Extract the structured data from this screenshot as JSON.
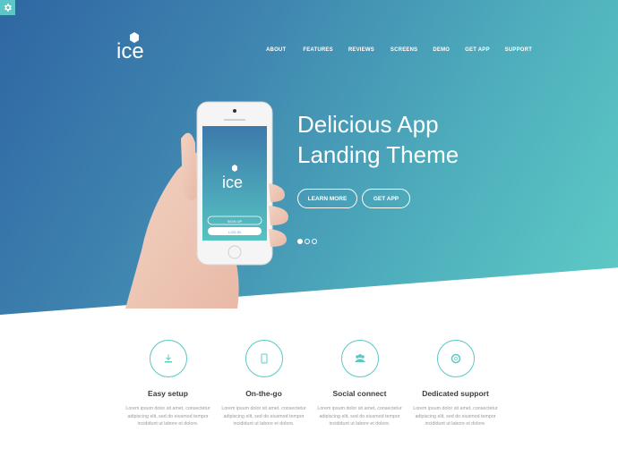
{
  "settings": {
    "icon": "gear-icon"
  },
  "logo": {
    "text": "ice"
  },
  "nav": {
    "items": [
      {
        "label": "ABOUT"
      },
      {
        "label": "FEATURES"
      },
      {
        "label": "REVIEWS"
      },
      {
        "label": "SCREENS"
      },
      {
        "label": "DEMO"
      },
      {
        "label": "GET APP"
      },
      {
        "label": "SUPPORT"
      }
    ]
  },
  "hero": {
    "headline_strong": "Delicious",
    "headline_rest": " App",
    "headline_line2": "Landing Theme",
    "learn_more": "LEARN MORE",
    "get_app": "GET APP",
    "phone": {
      "logo": "ice",
      "sign_up": "SIGN UP",
      "log_in": "LOG IN"
    },
    "slides": 3,
    "active_slide": 1
  },
  "features": [
    {
      "icon": "download-icon",
      "title": "Easy setup",
      "text": "Lorem ipsum dolor sit amet, consectetur adipiscing elit, sed do eiusmod tempor incididunt ut labore et dolore."
    },
    {
      "icon": "tablet-icon",
      "title": "On-the-go",
      "text": "Lorem ipsum dolor sit amet, consectetur adipiscing elit, sed do eiusmod tempor incididunt ut labore et dolore."
    },
    {
      "icon": "users-icon",
      "title": "Social connect",
      "text": "Lorem ipsum dolor sit amet, consectetur adipiscing elit, sed do eiusmod tempor incididunt ut labore et dolore."
    },
    {
      "icon": "lifebuoy-icon",
      "title": "Dedicated support",
      "text": "Lorem ipsum dolor sit amet, consectetur adipiscing elit, sed do eiusmod tempor incididunt ut labore et dolore."
    }
  ],
  "colors": {
    "accent": "#5cc8c4",
    "hero_start": "#2f66a3",
    "hero_end": "#5fcbc6"
  }
}
